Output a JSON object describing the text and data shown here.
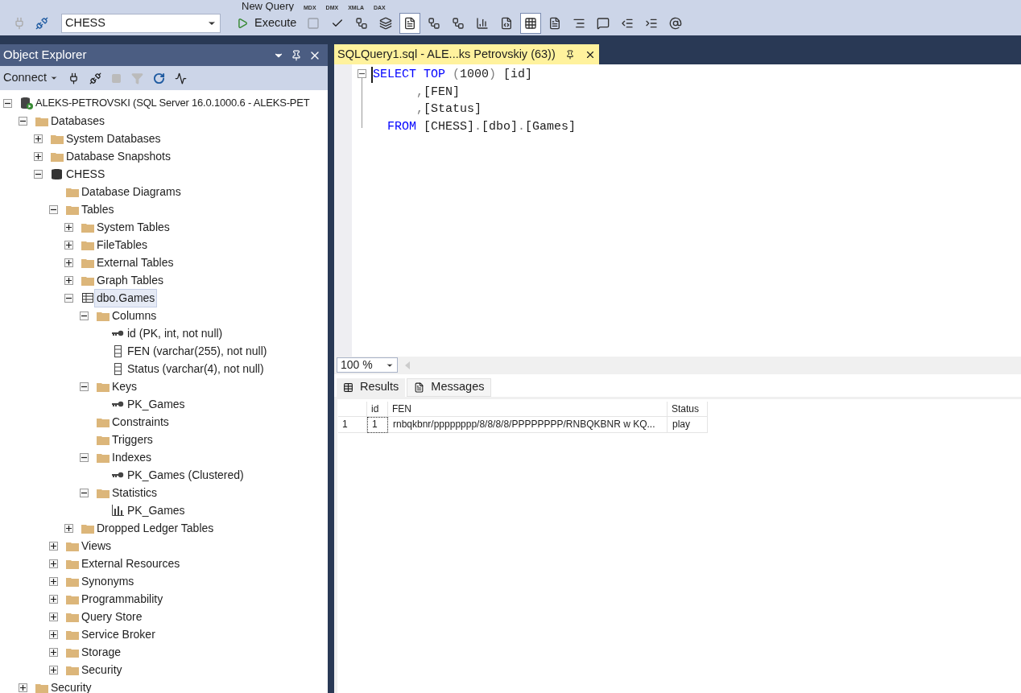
{
  "toolbar_top": {
    "new_query": "New Query",
    "script_labels": [
      "MDX",
      "DMX",
      "XMLA",
      "DAX"
    ]
  },
  "toolbar": {
    "database": "CHESS",
    "execute": "Execute",
    "buttons": [
      {
        "kind": "stop",
        "selected": false
      },
      {
        "kind": "parse",
        "selected": false
      },
      {
        "kind": "plan",
        "selected": false
      },
      {
        "kind": "windows",
        "selected": false
      },
      {
        "kind": "form",
        "selected": true
      },
      {
        "kind": "plan",
        "selected": false
      },
      {
        "kind": "plan-check",
        "selected": false
      },
      {
        "kind": "stats",
        "selected": false
      },
      {
        "kind": "text",
        "selected": false
      },
      {
        "kind": "grid",
        "selected": true
      },
      {
        "kind": "file",
        "selected": false
      },
      {
        "kind": "comment",
        "selected": false
      },
      {
        "kind": "uncomment",
        "selected": false
      },
      {
        "kind": "outdent",
        "selected": false
      },
      {
        "kind": "indent",
        "selected": false
      },
      {
        "kind": "params",
        "selected": false
      }
    ]
  },
  "object_explorer": {
    "title": "Object Explorer",
    "connect": "Connect",
    "tree": [
      {
        "label": "ALEKS-PETROVSKI (SQL Server 16.0.1000.6 - ALEKS-PET",
        "kind": "server",
        "expanded": true,
        "selected": false,
        "children": [
          {
            "label": "Databases",
            "kind": "folder",
            "expanded": true,
            "selected": false,
            "children": [
              {
                "label": "System Databases",
                "kind": "folder",
                "expanded": false,
                "selected": false
              },
              {
                "label": "Database Snapshots",
                "kind": "folder",
                "expanded": false,
                "selected": false
              },
              {
                "label": "CHESS",
                "kind": "database",
                "expanded": true,
                "selected": false,
                "children": [
                  {
                    "label": "Database Diagrams",
                    "kind": "folder",
                    "selected": false
                  },
                  {
                    "label": "Tables",
                    "kind": "folder",
                    "expanded": true,
                    "selected": false,
                    "children": [
                      {
                        "label": "System Tables",
                        "kind": "folder",
                        "expanded": false,
                        "selected": false
                      },
                      {
                        "label": "FileTables",
                        "kind": "folder",
                        "expanded": false,
                        "selected": false
                      },
                      {
                        "label": "External Tables",
                        "kind": "folder",
                        "expanded": false,
                        "selected": false
                      },
                      {
                        "label": "Graph Tables",
                        "kind": "folder",
                        "expanded": false,
                        "selected": false
                      },
                      {
                        "label": "dbo.Games",
                        "kind": "table",
                        "expanded": true,
                        "selected": true,
                        "children": [
                          {
                            "label": "Columns",
                            "kind": "folder",
                            "expanded": true,
                            "selected": false,
                            "children": [
                              {
                                "label": "id (PK, int, not null)",
                                "kind": "key",
                                "selected": false
                              },
                              {
                                "label": "FEN (varchar(255), not null)",
                                "kind": "column",
                                "selected": false
                              },
                              {
                                "label": "Status (varchar(4), not null)",
                                "kind": "column",
                                "selected": false
                              }
                            ]
                          },
                          {
                            "label": "Keys",
                            "kind": "folder",
                            "expanded": true,
                            "selected": false,
                            "children": [
                              {
                                "label": "PK_Games",
                                "kind": "key",
                                "selected": false
                              }
                            ]
                          },
                          {
                            "label": "Constraints",
                            "kind": "folder",
                            "selected": false
                          },
                          {
                            "label": "Triggers",
                            "kind": "folder",
                            "selected": false
                          },
                          {
                            "label": "Indexes",
                            "kind": "folder",
                            "expanded": true,
                            "selected": false,
                            "children": [
                              {
                                "label": "PK_Games (Clustered)",
                                "kind": "key",
                                "selected": false
                              }
                            ]
                          },
                          {
                            "label": "Statistics",
                            "kind": "folder",
                            "expanded": true,
                            "selected": false,
                            "children": [
                              {
                                "label": "PK_Games",
                                "kind": "stats",
                                "selected": false
                              }
                            ]
                          }
                        ]
                      },
                      {
                        "label": "Dropped Ledger Tables",
                        "kind": "folder",
                        "expanded": false,
                        "selected": false
                      }
                    ]
                  },
                  {
                    "label": "Views",
                    "kind": "folder",
                    "expanded": false,
                    "selected": false
                  },
                  {
                    "label": "External Resources",
                    "kind": "folder",
                    "expanded": false,
                    "selected": false
                  },
                  {
                    "label": "Synonyms",
                    "kind": "folder",
                    "expanded": false,
                    "selected": false
                  },
                  {
                    "label": "Programmability",
                    "kind": "folder",
                    "expanded": false,
                    "selected": false
                  },
                  {
                    "label": "Query Store",
                    "kind": "folder",
                    "expanded": false,
                    "selected": false
                  },
                  {
                    "label": "Service Broker",
                    "kind": "folder",
                    "expanded": false,
                    "selected": false
                  },
                  {
                    "label": "Storage",
                    "kind": "folder",
                    "expanded": false,
                    "selected": false
                  },
                  {
                    "label": "Security",
                    "kind": "folder",
                    "expanded": false,
                    "selected": false
                  }
                ]
              }
            ]
          },
          {
            "label": "Security",
            "kind": "folder",
            "expanded": false,
            "selected": false
          }
        ]
      }
    ]
  },
  "editor": {
    "tab": {
      "title": "SQLQuery1.sql - ALE...ks Petrovskiy (63))",
      "selected": true
    },
    "lines": [
      [
        {
          "text": "SELECT TOP ",
          "kind": "keyword"
        },
        {
          "text": "(",
          "kind": "operator"
        },
        {
          "text": "1000",
          "kind": "plain"
        },
        {
          "text": ")",
          "kind": "operator"
        },
        {
          "text": " [id]",
          "kind": "plain"
        }
      ],
      [
        {
          "text": "      ,",
          "kind": "operator"
        },
        {
          "text": "[FEN]",
          "kind": "plain"
        }
      ],
      [
        {
          "text": "      ,",
          "kind": "operator"
        },
        {
          "text": "[Status]",
          "kind": "plain"
        }
      ],
      [
        {
          "text": "  FROM ",
          "kind": "keyword"
        },
        {
          "text": "[CHESS]",
          "kind": "plain"
        },
        {
          "text": ".",
          "kind": "operator"
        },
        {
          "text": "[dbo]",
          "kind": "plain"
        },
        {
          "text": ".",
          "kind": "operator"
        },
        {
          "text": "[Games]",
          "kind": "plain"
        }
      ]
    ],
    "zoom": "100 %"
  },
  "results": {
    "tabs": [
      {
        "label": "Results",
        "selected": true
      },
      {
        "label": "Messages",
        "selected": false
      }
    ],
    "columns": [
      "id",
      "FEN",
      "Status"
    ],
    "rows": [
      {
        "number": "1",
        "cells": [
          "1",
          "rnbqkbnr/pppppppp/8/8/8/8/PPPPPPPP/RNBQKBNR w KQ...",
          "play"
        ]
      }
    ]
  }
}
